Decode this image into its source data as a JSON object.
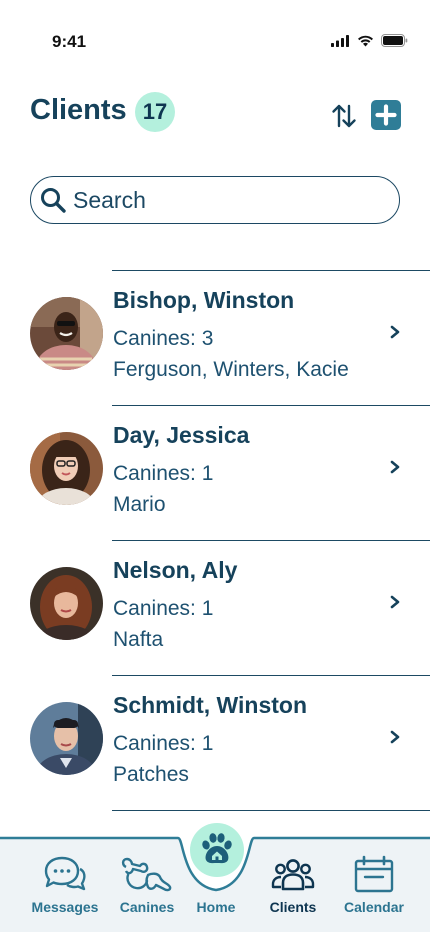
{
  "status_bar": {
    "time": "9:41"
  },
  "header": {
    "title": "Clients",
    "count": "17"
  },
  "search": {
    "placeholder": "Search"
  },
  "clients": [
    {
      "name": "Bishop, Winston",
      "canines": "Canines: 3",
      "dogs": "Ferguson, Winters, Kacie"
    },
    {
      "name": "Day, Jessica",
      "canines": "Canines: 1",
      "dogs": "Mario"
    },
    {
      "name": "Nelson, Aly",
      "canines": "Canines: 1",
      "dogs": "Nafta"
    },
    {
      "name": "Schmidt, Winston",
      "canines": "Canines: 1",
      "dogs": "Patches"
    }
  ],
  "nav": {
    "messages": "Messages",
    "canines": "Canines",
    "home": "Home",
    "clients": "Clients",
    "calendar": "Calendar",
    "active": "clients"
  },
  "colors": {
    "primary": "#16425b",
    "accent": "#2f7d97",
    "mint": "#b4f0dd"
  }
}
